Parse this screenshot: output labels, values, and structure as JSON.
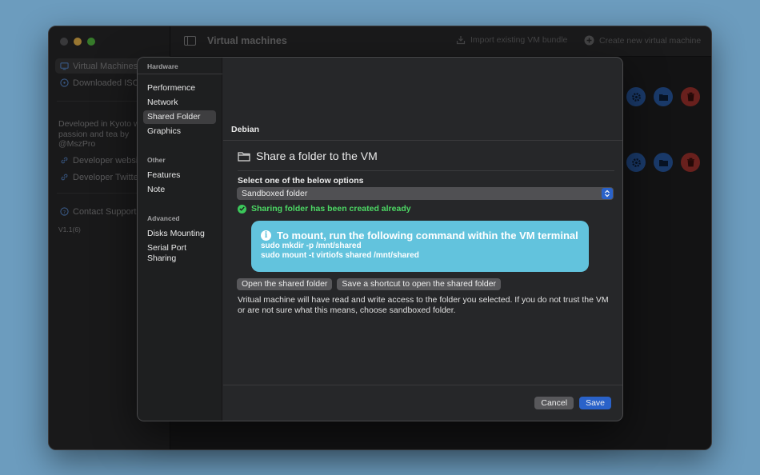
{
  "window": {
    "toolbar_title": "Virtual machines",
    "import_label": "Import existing VM bundle",
    "create_label": "Create new virtual machine"
  },
  "sidebar": {
    "items": [
      {
        "label": "Virtual Machines",
        "icon": "monitor-icon"
      },
      {
        "label": "Downloaded ISO",
        "icon": "disc-icon"
      }
    ],
    "about_text": "Developed in Kyoto with passion and tea by @MszPro",
    "links": [
      {
        "label": "Developer website",
        "icon": "link-icon"
      },
      {
        "label": "Developer Twitter",
        "icon": "link-icon"
      }
    ],
    "contact_label": "Contact Support",
    "version": "V1.1(6)"
  },
  "settings_sheet": {
    "sections": [
      {
        "title": "Hardware",
        "items": [
          "Performence",
          "Network",
          "Shared Folder",
          "Graphics"
        ]
      },
      {
        "title": "Other",
        "items": [
          "Features",
          "Note"
        ]
      },
      {
        "title": "Advanced",
        "items": [
          "Disks Mounting",
          "Serial Port Sharing"
        ]
      }
    ],
    "active_item": "Shared Folder",
    "vm_name": "Debian",
    "heading": "Share a folder to the VM",
    "select_label": "Select one of the below options",
    "select_value": "Sandboxed folder",
    "status_text": "Sharing folder has been created already",
    "info": {
      "title": "To mount, run the following command within the VM terminal",
      "cmd1": "sudo mkdir -p /mnt/shared",
      "cmd2": "sudo mount -t virtiofs shared /mnt/shared"
    },
    "open_button": "Open the shared folder",
    "shortcut_button": "Save a shortcut to open the shared folder",
    "note": "Vritual machine will have read and write access to the folder you selected. If you do not trust the VM or are not sure what this means, choose sandboxed folder.",
    "cancel_button": "Cancel",
    "save_button": "Save"
  },
  "colors": {
    "accent": "#2a62c9",
    "info_box": "#62c3dd",
    "success": "#4cd764",
    "delete": "#a8352f"
  }
}
